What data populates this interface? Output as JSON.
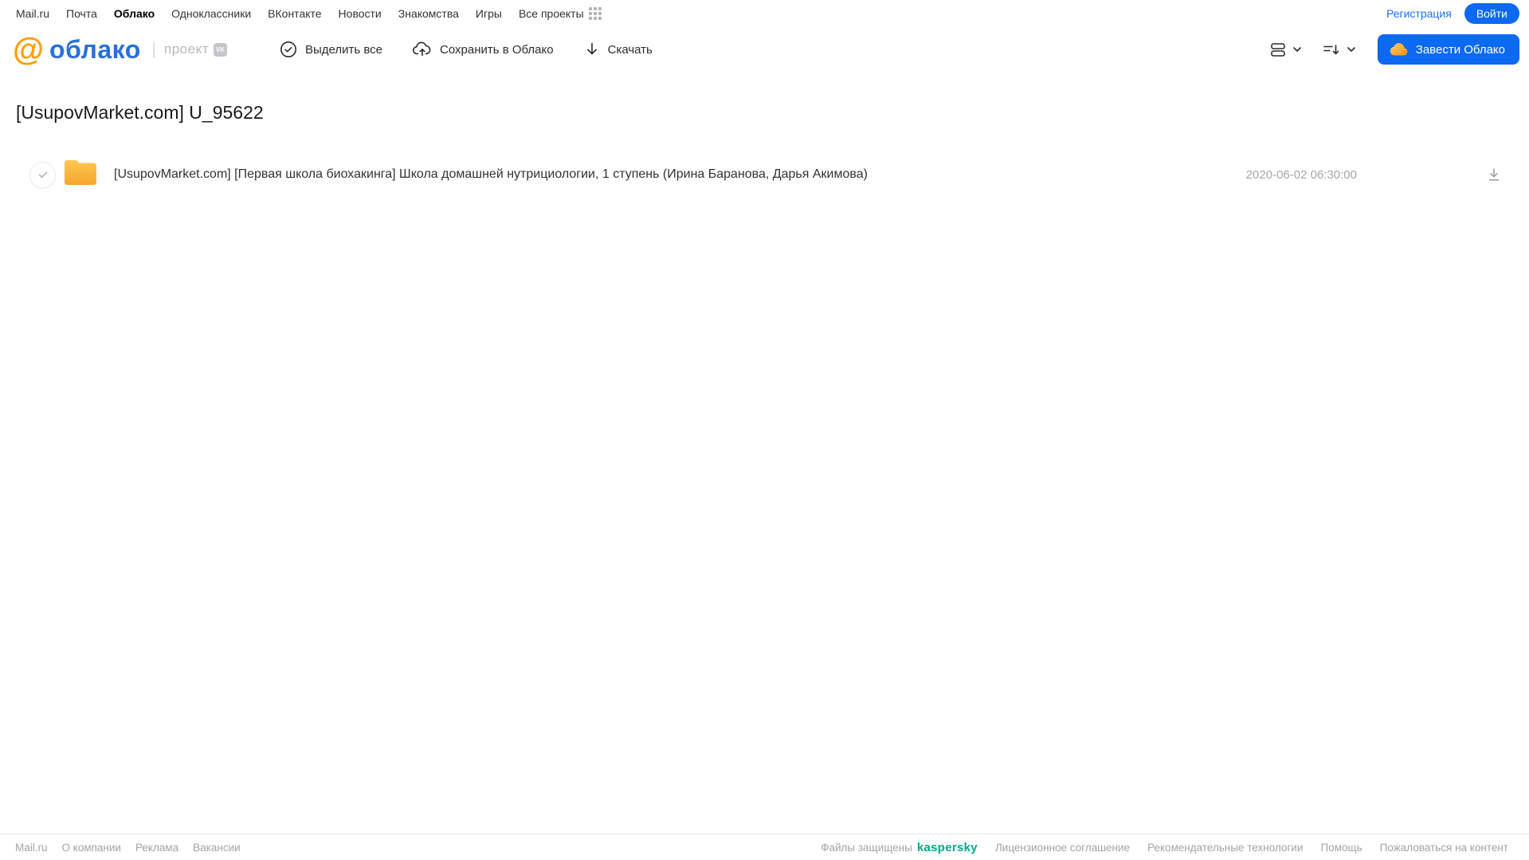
{
  "topnav": {
    "items": [
      {
        "label": "Mail.ru",
        "active": false
      },
      {
        "label": "Почта",
        "active": false
      },
      {
        "label": "Облако",
        "active": true
      },
      {
        "label": "Одноклассники",
        "active": false
      },
      {
        "label": "ВКонтакте",
        "active": false
      },
      {
        "label": "Новости",
        "active": false
      },
      {
        "label": "Знакомства",
        "active": false
      },
      {
        "label": "Игры",
        "active": false
      },
      {
        "label": "Все проекты",
        "active": false
      }
    ],
    "registration_label": "Регистрация",
    "login_label": "Войти"
  },
  "header": {
    "logo": {
      "at": "@",
      "word": "облако",
      "suffix": "проект",
      "vk_badge": "VK"
    },
    "toolbar": {
      "select_all_label": "Выделить все",
      "save_to_cloud_label": "Сохранить в Облако",
      "download_label": "Скачать"
    },
    "create_cloud_label": "Завести Облако"
  },
  "main": {
    "title": "[UsupovMarket.com] U_95622",
    "files": [
      {
        "type": "folder",
        "name": "[UsupovMarket.com] [Первая школа биохакинга] Школа домашней нутрициологии, 1 ступень (Ирина Баранова, Дарья Акимова)",
        "date": "2020-06-02 06:30:00"
      }
    ]
  },
  "footer": {
    "left_links": [
      "Mail.ru",
      "О компании",
      "Реклама",
      "Вакансии"
    ],
    "protected_label": "Файлы защищены",
    "kaspersky_label": "kaspersky",
    "right_links": [
      "Лицензионное соглашение",
      "Рекомендательные технологии",
      "Помощь",
      "Пожаловаться на контент"
    ]
  },
  "colors": {
    "accent_blue": "#0b69f2",
    "logo_orange": "#ff9e00",
    "logo_blue": "#2a6fdb",
    "folder_yellow": "#ffb836",
    "kaspersky_green": "#00a88e",
    "muted_gray": "#a3a3a3"
  }
}
